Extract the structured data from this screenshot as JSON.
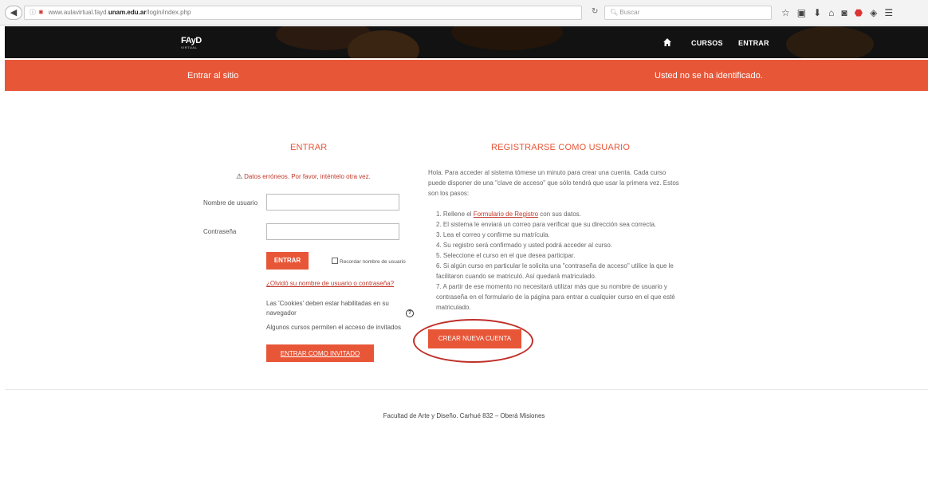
{
  "browser": {
    "url_prefix": "www.aulavirtual.fayd.",
    "url_domain": "unam.edu.ar",
    "url_path": "/login/index.php",
    "search_placeholder": "Buscar"
  },
  "header": {
    "brand_main": "FAyD",
    "brand_sub": "VIRTUAL",
    "nav_cursos": "CURSOS",
    "nav_entrar": "ENTRAR"
  },
  "banner": {
    "left": "Entrar al sitio",
    "right": "Usted no se ha identificado."
  },
  "login": {
    "title": "ENTRAR",
    "error": "Datos erróneos. Por favor, inténtelo otra vez.",
    "username_label": "Nombre de usuario",
    "password_label": "Contraseña",
    "submit_label": "ENTRAR",
    "remember_label": "Recordar nombre de usuario",
    "forgot_link": "¿Olvidó su nombre de usuario o contraseña?",
    "cookies_note": "Las 'Cookies' deben estar habilitadas en su navegador",
    "guests_note": "Algunos cursos permiten el acceso de invitados",
    "guest_button": "ENTRAR COMO INVITADO"
  },
  "register": {
    "title": "REGISTRARSE COMO USUARIO",
    "intro": "Hola. Para acceder al sistema tómese un minuto para crear una cuenta. Cada curso puede disponer de una \"clave de acceso\" que sólo tendrá que usar la primera vez. Estos son los pasos:",
    "step1_pre": "1. Rellene el ",
    "step1_link": "Formulario de Registro",
    "step1_post": " con sus datos.",
    "step2": "2. El sistema le enviará un correo para verificar que su dirección sea correcta.",
    "step3": "3. Lea el correo y confirme su matrícula.",
    "step4": "4. Su registro será confirmado y usted podrá acceder al curso.",
    "step5": "5. Seleccione el curso en el que desea participar.",
    "step6": "6. Si algún curso en particular le solicita una \"contraseña de acceso\" utilice la que le facilitaron cuando se matriculó. Así quedará matriculado.",
    "step7": "7. A partir de ese momento no necesitará utilizar más que su nombre de usuario y contraseña en el formulario de la página para entrar a cualquier curso en el que esté matriculado.",
    "create_button": "CREAR NUEVA CUENTA"
  },
  "footer": {
    "text": "Facultad de Arte y Diseño. Carhué 832 – Oberá Misiones"
  },
  "colors": {
    "accent": "#e85638",
    "header_bg": "#121212",
    "highlight": "#c0302a"
  }
}
